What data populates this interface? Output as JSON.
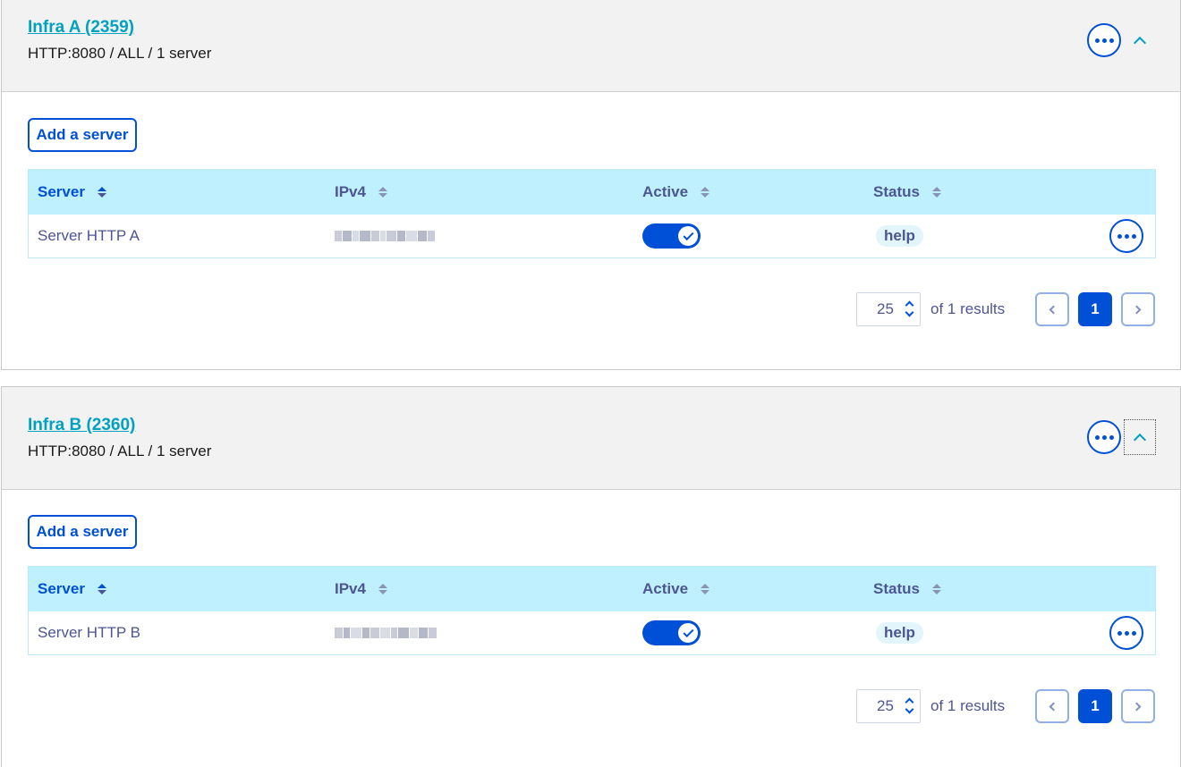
{
  "infras": [
    {
      "title": "Infra A (2359)",
      "subtitle": "HTTP:8080 / ALL / 1 server",
      "add_label": "Add a server",
      "columns": {
        "server": "Server",
        "ipv4": "IPv4",
        "active": "Active",
        "status": "Status"
      },
      "rows": [
        {
          "server": "Server HTTP A",
          "ipv4": "",
          "active": true,
          "status": "help"
        }
      ],
      "pagination": {
        "per_page": "25",
        "results": "of 1 results",
        "current_page": "1"
      }
    },
    {
      "title": "Infra B (2360)",
      "subtitle": "HTTP:8080 / ALL / 1 server",
      "add_label": "Add a server",
      "columns": {
        "server": "Server",
        "ipv4": "IPv4",
        "active": "Active",
        "status": "Status"
      },
      "rows": [
        {
          "server": "Server HTTP B",
          "ipv4": "",
          "active": true,
          "status": "help"
        }
      ],
      "pagination": {
        "per_page": "25",
        "results": "of 1 results",
        "current_page": "1"
      }
    }
  ],
  "icons": {
    "header_more": "more-horizontal-icon",
    "collapse": "chevron-up-icon",
    "sort": "sort-icon",
    "toggle_check": "check-icon",
    "row_more": "more-horizontal-icon",
    "prev": "chevron-left-icon",
    "next": "chevron-right-icon"
  },
  "colors": {
    "primary": "#0050d7",
    "title_link": "#00a2bf",
    "table_header_bg": "#bef1fd",
    "header_bg": "#f2f2f2",
    "text_muted": "#4d5592"
  }
}
